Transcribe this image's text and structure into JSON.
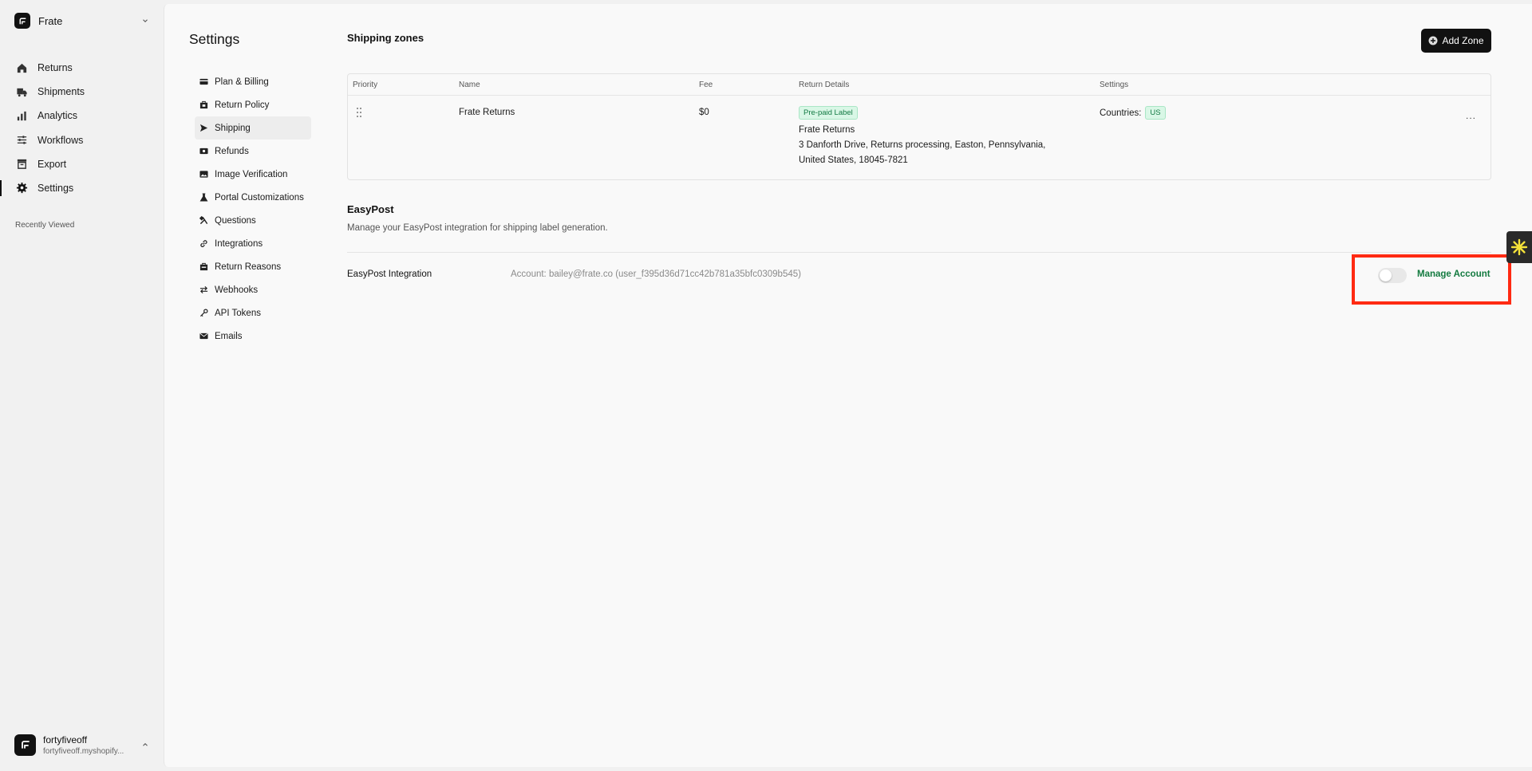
{
  "workspace": {
    "name": "Frate"
  },
  "nav": {
    "items": [
      {
        "label": "Returns",
        "icon": "home-icon"
      },
      {
        "label": "Shipments",
        "icon": "shipments-icon"
      },
      {
        "label": "Analytics",
        "icon": "bar-chart-icon"
      },
      {
        "label": "Workflows",
        "icon": "sliders-icon"
      },
      {
        "label": "Export",
        "icon": "archive-icon"
      },
      {
        "label": "Settings",
        "icon": "gear-icon"
      }
    ],
    "active": "Settings"
  },
  "recently_viewed": {
    "label": "Recently Viewed"
  },
  "store": {
    "name": "fortyfiveoff",
    "domain": "fortyfiveoff.myshopify..."
  },
  "settings": {
    "title": "Settings",
    "menu": [
      {
        "label": "Plan & Billing",
        "icon": "credit-card-icon"
      },
      {
        "label": "Return Policy",
        "icon": "policy-icon"
      },
      {
        "label": "Shipping",
        "icon": "send-icon"
      },
      {
        "label": "Refunds",
        "icon": "refund-icon"
      },
      {
        "label": "Image Verification",
        "icon": "image-icon"
      },
      {
        "label": "Portal Customizations",
        "icon": "flask-icon"
      },
      {
        "label": "Questions",
        "icon": "tools-icon"
      },
      {
        "label": "Integrations",
        "icon": "link-icon"
      },
      {
        "label": "Return Reasons",
        "icon": "reasons-icon"
      },
      {
        "label": "Webhooks",
        "icon": "swap-icon"
      },
      {
        "label": "API Tokens",
        "icon": "key-icon"
      },
      {
        "label": "Emails",
        "icon": "mail-icon"
      }
    ],
    "active": "Shipping"
  },
  "shipping_zones": {
    "title": "Shipping zones",
    "add_button": "Add Zone",
    "columns": [
      "Priority",
      "Name",
      "Fee",
      "Return Details",
      "Settings"
    ],
    "rows": [
      {
        "name": "Frate Returns",
        "fee": "$0",
        "badge": "Pre-paid Label",
        "details_name": "Frate Returns",
        "address_line1": "3 Danforth Drive, Returns processing, Easton, Pennsylvania,",
        "address_line2": "United States, 18045-7821",
        "countries_label": "Countries:",
        "country": "US",
        "more": "..."
      }
    ]
  },
  "easypost": {
    "title": "EasyPost",
    "description": "Manage your EasyPost integration for shipping label generation.",
    "integration_label": "EasyPost Integration",
    "account": "Account: bailey@frate.co (user_f395d36d71cc42b781a35bfc0309b545)",
    "toggle_on": false,
    "manage_label": "Manage Account"
  },
  "colors": {
    "accent_green": "#127a3f",
    "highlight": "#ff2a12",
    "button_dark": "#111111"
  }
}
